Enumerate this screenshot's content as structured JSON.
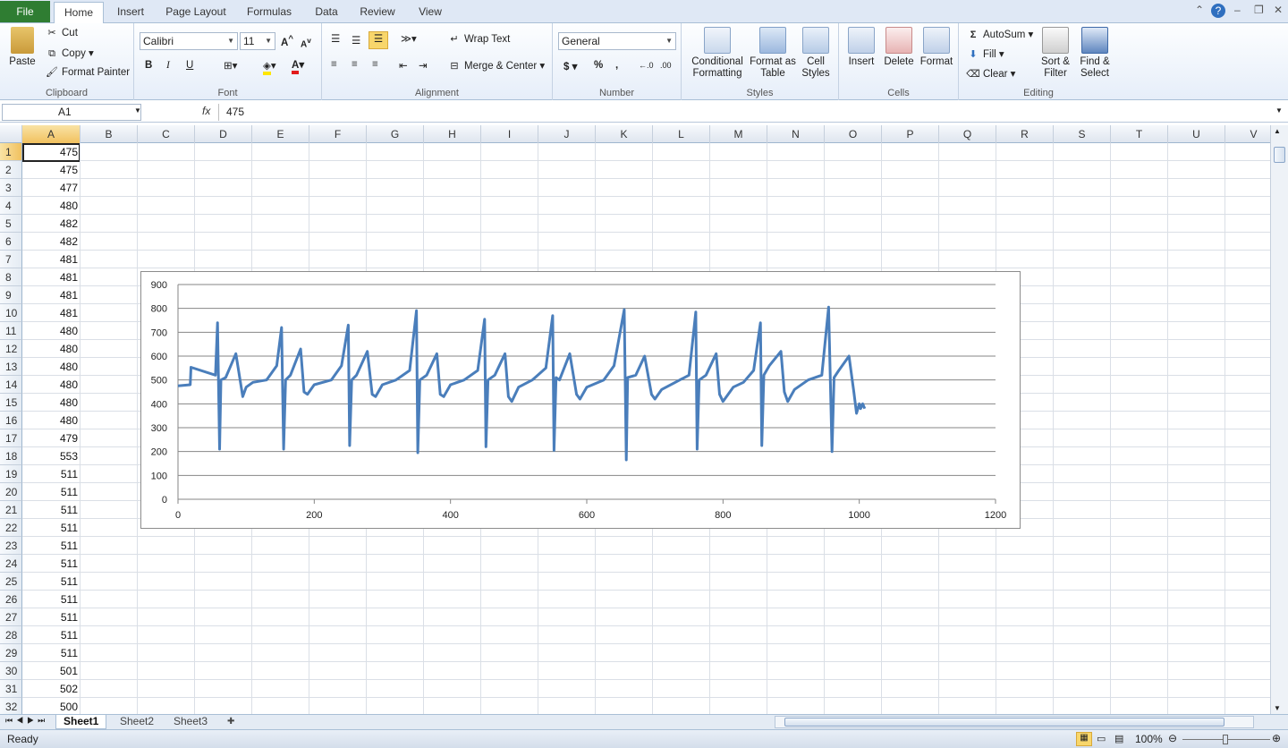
{
  "ribbon_tabs": {
    "file": "File",
    "home": "Home",
    "insert": "Insert",
    "page_layout": "Page Layout",
    "formulas": "Formulas",
    "data": "Data",
    "review": "Review",
    "view": "View"
  },
  "clipboard": {
    "paste": "Paste",
    "cut": "Cut",
    "copy": "Copy",
    "format_painter": "Format Painter",
    "label": "Clipboard"
  },
  "font": {
    "name": "Calibri",
    "size": "11",
    "label": "Font",
    "bold": "B",
    "italic": "I",
    "underline": "U"
  },
  "alignment": {
    "wrap_text": "Wrap Text",
    "merge_center": "Merge & Center",
    "label": "Alignment"
  },
  "number": {
    "format": "General",
    "currency": "$",
    "percent": "%",
    "comma": ",",
    "inc_decimal": "←.0 .00",
    "dec_decimal": ".00 →.0",
    "label": "Number"
  },
  "styles": {
    "conditional": "Conditional Formatting",
    "format_table": "Format as Table",
    "cell_styles": "Cell Styles",
    "label": "Styles"
  },
  "cells": {
    "insert": "Insert",
    "delete": "Delete",
    "format": "Format",
    "label": "Cells"
  },
  "editing": {
    "autosum": "AutoSum",
    "fill": "Fill",
    "clear": "Clear",
    "sort_filter": "Sort & Filter",
    "find_select": "Find & Select",
    "label": "Editing"
  },
  "formula_bar": {
    "name_box": "A1",
    "fx": "fx",
    "value": "475"
  },
  "columns": [
    "A",
    "B",
    "C",
    "D",
    "E",
    "F",
    "G",
    "H",
    "I",
    "J",
    "K",
    "L",
    "M",
    "N",
    "O",
    "P",
    "Q",
    "R",
    "S",
    "T",
    "U",
    "V"
  ],
  "rows": [
    "1",
    "2",
    "3",
    "4",
    "5",
    "6",
    "7",
    "8",
    "9",
    "10",
    "11",
    "12",
    "13",
    "14",
    "15",
    "16",
    "17",
    "18",
    "19",
    "20",
    "21",
    "22",
    "23",
    "24",
    "25",
    "26",
    "27",
    "28",
    "29",
    "30",
    "31",
    "32"
  ],
  "column_a": [
    "475",
    "475",
    "477",
    "480",
    "482",
    "482",
    "481",
    "481",
    "481",
    "481",
    "480",
    "480",
    "480",
    "480",
    "480",
    "480",
    "479",
    "553",
    "511",
    "511",
    "511",
    "511",
    "511",
    "511",
    "511",
    "511",
    "511",
    "511",
    "511",
    "501",
    "502",
    "500"
  ],
  "sheets": [
    "Sheet1",
    "Sheet2",
    "Sheet3"
  ],
  "status": {
    "ready": "Ready",
    "zoom": "100%"
  },
  "chart_data": {
    "type": "line",
    "title": "",
    "xlabel": "",
    "ylabel": "",
    "xlim": [
      0,
      1200
    ],
    "ylim": [
      0,
      900
    ],
    "x_ticks": [
      "0",
      "200",
      "400",
      "600",
      "800",
      "1000",
      "1200"
    ],
    "y_ticks": [
      "0",
      "100",
      "200",
      "300",
      "400",
      "500",
      "600",
      "700",
      "800",
      "900"
    ],
    "grid": "horizontal",
    "color": "#4a7ebb",
    "series": [
      {
        "x": [
          0,
          18,
          19,
          55,
          58,
          61,
          63,
          70,
          85,
          95,
          100,
          110,
          130,
          145,
          152,
          155,
          158,
          165,
          180,
          185,
          190,
          200,
          225,
          240,
          250,
          252,
          255,
          262,
          278,
          285,
          290,
          300,
          320,
          340,
          350,
          352,
          355,
          365,
          380,
          385,
          390,
          400,
          420,
          440,
          450,
          452,
          455,
          465,
          480,
          485,
          490,
          500,
          520,
          540,
          550,
          552,
          555,
          560,
          575,
          585,
          590,
          600,
          625,
          640,
          655,
          658,
          660,
          672,
          685,
          695,
          700,
          710,
          730,
          750,
          760,
          762,
          765,
          775,
          790,
          795,
          800,
          815,
          830,
          845,
          855,
          857,
          860,
          868,
          885,
          890,
          895,
          905,
          925,
          945,
          955,
          960,
          963,
          970,
          985,
          992,
          996,
          1000,
          1002,
          1005,
          1008
        ],
        "y": [
          475,
          480,
          553,
          520,
          740,
          210,
          500,
          510,
          610,
          430,
          470,
          490,
          500,
          560,
          720,
          210,
          500,
          520,
          630,
          450,
          440,
          480,
          500,
          560,
          730,
          225,
          500,
          520,
          620,
          440,
          430,
          480,
          500,
          540,
          790,
          195,
          500,
          520,
          610,
          440,
          430,
          480,
          500,
          540,
          755,
          220,
          500,
          520,
          610,
          430,
          410,
          470,
          500,
          550,
          770,
          205,
          510,
          500,
          610,
          440,
          420,
          470,
          500,
          560,
          795,
          165,
          510,
          520,
          600,
          440,
          420,
          460,
          490,
          520,
          785,
          210,
          500,
          520,
          610,
          440,
          410,
          470,
          490,
          540,
          740,
          225,
          520,
          560,
          620,
          450,
          410,
          460,
          500,
          520,
          805,
          200,
          510,
          540,
          600,
          450,
          360,
          400,
          380,
          400,
          380
        ]
      }
    ]
  }
}
